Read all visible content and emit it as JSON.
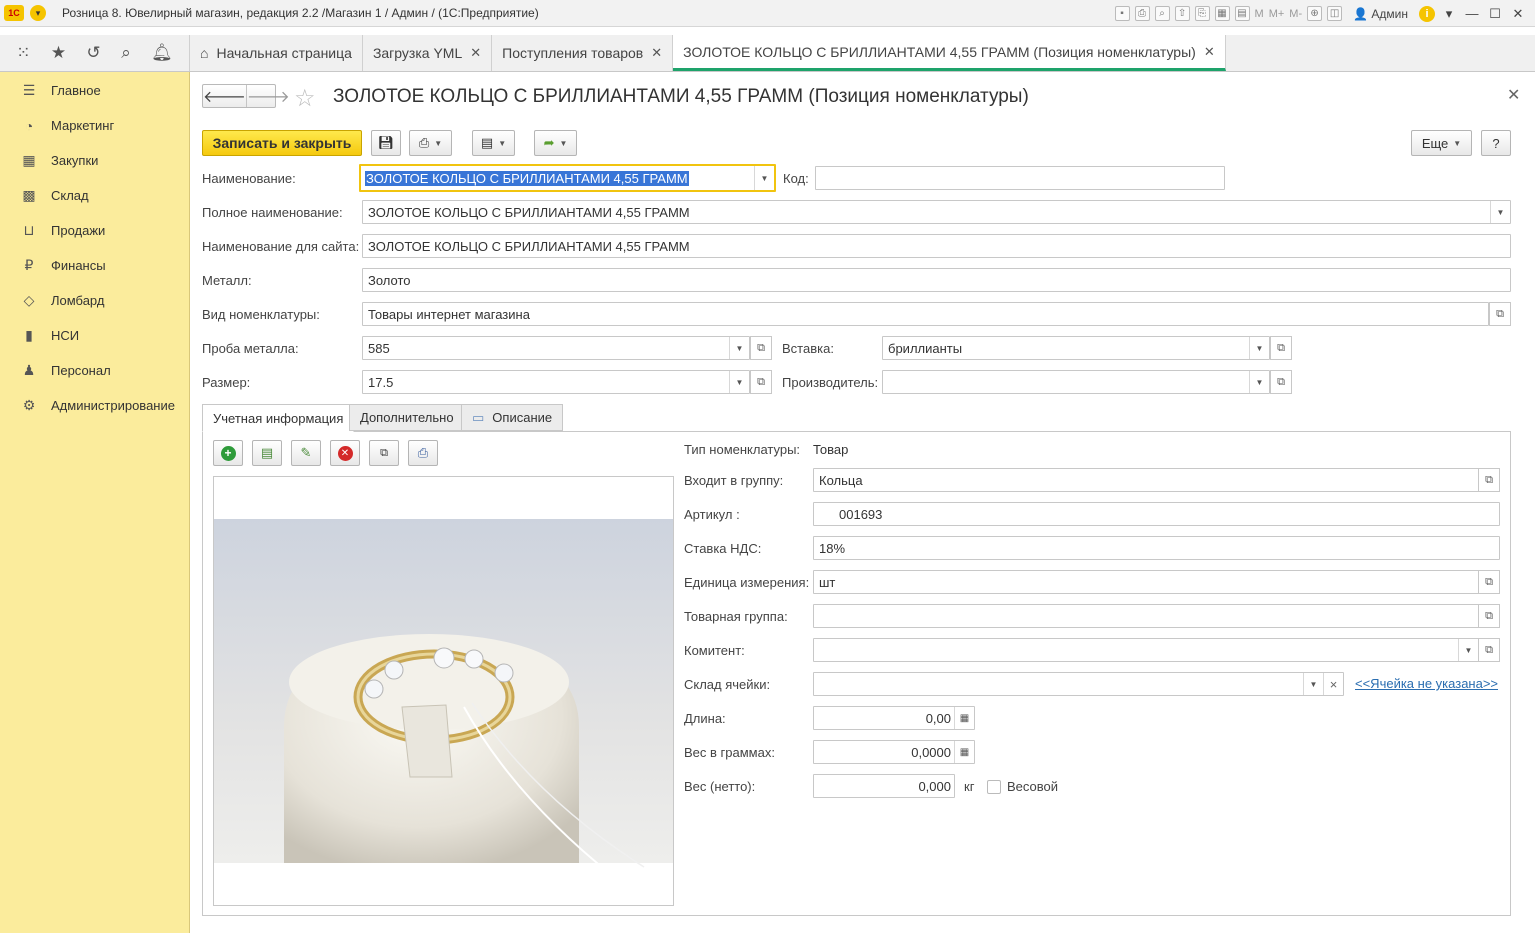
{
  "window": {
    "title": "Розница 8. Ювелирный магазин, редакция 2.2 /Магазин 1 / Админ /  (1С:Предприятие)",
    "user": "Админ",
    "m_labels": [
      "M",
      "M+",
      "M-"
    ]
  },
  "tabs": [
    {
      "label": "Начальная страница"
    },
    {
      "label": "Загрузка YML"
    },
    {
      "label": "Поступления товаров"
    },
    {
      "label": "ЗОЛОТОЕ КОЛЬЦО С БРИЛЛИАНТАМИ 4,55 ГРАММ (Позиция номенклатуры)"
    }
  ],
  "sidebar": {
    "items": [
      {
        "label": "Главное",
        "icon": "menu-icon"
      },
      {
        "label": "Маркетинг",
        "icon": "pie-chart-icon"
      },
      {
        "label": "Закупки",
        "icon": "cart-icon"
      },
      {
        "label": "Склад",
        "icon": "warehouse-icon"
      },
      {
        "label": "Продажи",
        "icon": "basket-icon"
      },
      {
        "label": "Финансы",
        "icon": "ruble-icon"
      },
      {
        "label": "Ломбард",
        "icon": "diamond-icon"
      },
      {
        "label": "НСИ",
        "icon": "book-icon"
      },
      {
        "label": "Персонал",
        "icon": "person-icon"
      },
      {
        "label": "Администрирование",
        "icon": "gear-icon"
      }
    ]
  },
  "form": {
    "title": "ЗОЛОТОЕ КОЛЬЦО С БРИЛЛИАНТАМИ 4,55 ГРАММ (Позиция номенклатуры)",
    "save_close": "Записать и закрыть",
    "more": "Еще",
    "help": "?",
    "fields": {
      "name_label": "Наименование:",
      "name_value": "ЗОЛОТОЕ КОЛЬЦО С БРИЛЛИАНТАМИ 4,55 ГРАММ",
      "code_label": "Код:",
      "code_value": "",
      "full_name_label": "Полное наименование:",
      "full_name_value": "ЗОЛОТОЕ КОЛЬЦО С БРИЛЛИАНТАМИ 4,55 ГРАММ",
      "site_name_label": "Наименование для сайта:",
      "site_name_value": "ЗОЛОТОЕ КОЛЬЦО С БРИЛЛИАНТАМИ 4,55 ГРАММ",
      "metal_label": "Металл:",
      "metal_value": "Золото",
      "kind_label": "Вид номенклатуры:",
      "kind_value": "Товары интернет магазина",
      "probe_label": "Проба металла:",
      "probe_value": "585",
      "insert_label": "Вставка:",
      "insert_value": "бриллианты",
      "size_label": "Размер:",
      "size_value": "17.5",
      "maker_label": "Производитель:",
      "maker_value": ""
    },
    "inner_tabs": [
      "Учетная информация",
      "Дополнительно",
      "Описание"
    ],
    "account": {
      "type_label": "Тип номенклатуры:",
      "type_value": "Товар",
      "group_label": "Входит в группу:",
      "group_value": "Кольца",
      "article_label": "Артикул :",
      "article_value": "001693",
      "vat_label": "Ставка НДС:",
      "vat_value": "18%",
      "unit_label": "Единица измерения:",
      "unit_value": "шт",
      "goods_group_label": "Товарная группа:",
      "goods_group_value": "",
      "committent_label": "Комитент:",
      "committent_value": "",
      "cell_label": "Склад ячейки:",
      "cell_value": "",
      "cell_link": "<<Ячейка не указана>>",
      "length_label": "Длина:",
      "length_value": "0,00",
      "weight_label": "Вес в граммах:",
      "weight_value": "0,0000",
      "net_label": "Вес (нетто):",
      "net_value": "0,000",
      "net_unit": "кг",
      "weighted_label": "Весовой"
    }
  },
  "colors": {
    "sidebar_bg": "#fbec9c",
    "primary_button": "#f5c90e",
    "active_tab_underline": "#1ea36b",
    "link": "#2a6db0"
  }
}
